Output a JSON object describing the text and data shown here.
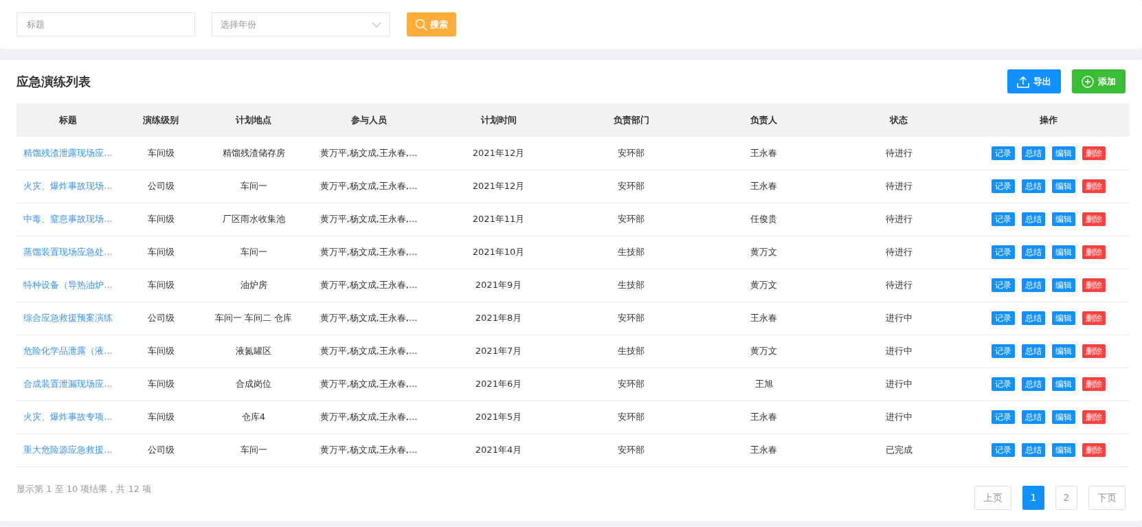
{
  "filters": {
    "title_placeholder": "标题",
    "year_placeholder": "选择年份",
    "search_button": "搜索"
  },
  "list": {
    "heading": "应急演练列表",
    "export_button": "导出",
    "add_button": "添加",
    "columns": [
      "标题",
      "演练级别",
      "计划地点",
      "参与人员",
      "计划时间",
      "负责部门",
      "负责人",
      "状态",
      "操作"
    ],
    "rows": [
      {
        "title": "精馏残渣泄露现场应...",
        "level": "车间级",
        "place": "精馏残渣储存房",
        "people": "黄万平,杨文成,王永春,...",
        "time": "2021年12月",
        "dept": "安环部",
        "owner": "王永春",
        "status": "待进行",
        "actions": [
          "记录",
          "总结",
          "编辑",
          "删除"
        ]
      },
      {
        "title": "火灾、爆炸事故现场...",
        "level": "公司级",
        "place": "车间一",
        "people": "黄万平,杨文成,王永春,...",
        "time": "2021年12月",
        "dept": "安环部",
        "owner": "王永春",
        "status": "待进行",
        "actions": [
          "记录",
          "总结",
          "编辑",
          "删除"
        ]
      },
      {
        "title": "中毒、窒息事故现场...",
        "level": "车间级",
        "place": "厂区雨水收集池",
        "people": "黄万平,杨文成,王永春,...",
        "time": "2021年11月",
        "dept": "安环部",
        "owner": "任俊贵",
        "status": "待进行",
        "actions": [
          "记录",
          "总结",
          "编辑",
          "删除"
        ]
      },
      {
        "title": "蒸馏装置现场应急处...",
        "level": "车间级",
        "place": "车间一",
        "people": "黄万平,杨文成,王永春,...",
        "time": "2021年10月",
        "dept": "生技部",
        "owner": "黄万文",
        "status": "待进行",
        "actions": [
          "记录",
          "总结",
          "编辑",
          "删除"
        ]
      },
      {
        "title": "特种设备（导热油炉...",
        "level": "车间级",
        "place": "油炉房",
        "people": "黄万平,杨文成,王永春,...",
        "time": "2021年9月",
        "dept": "生技部",
        "owner": "黄万文",
        "status": "待进行",
        "actions": [
          "记录",
          "总结",
          "编辑",
          "删除"
        ]
      },
      {
        "title": "综合应急救援预案演练",
        "level": "公司级",
        "place": "车间一 车间二 仓库",
        "people": "黄万平,杨文成,王永春,...",
        "time": "2021年8月",
        "dept": "安环部",
        "owner": "王永春",
        "status": "进行中",
        "actions": [
          "记录",
          "总结",
          "编辑",
          "删除"
        ]
      },
      {
        "title": "危险化学品泄露（液...",
        "level": "车间级",
        "place": "液氮罐区",
        "people": "黄万平,杨文成,王永春,...",
        "time": "2021年7月",
        "dept": "生技部",
        "owner": "黄万文",
        "status": "进行中",
        "actions": [
          "记录",
          "总结",
          "编辑",
          "删除"
        ]
      },
      {
        "title": "合成装置泄漏现场应...",
        "level": "车间级",
        "place": "合成岗位",
        "people": "黄万平,杨文成,王永春,...",
        "time": "2021年6月",
        "dept": "安环部",
        "owner": "王旭",
        "status": "进行中",
        "actions": [
          "记录",
          "总结",
          "编辑",
          "删除"
        ]
      },
      {
        "title": "火灾、爆炸事故专项...",
        "level": "车间级",
        "place": "仓库4",
        "people": "黄万平,杨文成,王永春,...",
        "time": "2021年5月",
        "dept": "安环部",
        "owner": "王永春",
        "status": "进行中",
        "actions": [
          "记录",
          "总结",
          "编辑",
          "删除"
        ]
      },
      {
        "title": "重大危险源应急救援...",
        "level": "公司级",
        "place": "车间一",
        "people": "黄万平,杨文成,王永春,...",
        "time": "2021年4月",
        "dept": "安环部",
        "owner": "王永春",
        "status": "已完成",
        "actions": [
          "记录",
          "总结",
          "编辑",
          "删除"
        ]
      }
    ],
    "summary": "显示第 1 至 10 项结果，共 12 项",
    "pagination": [
      {
        "label": "上页",
        "kind": "nav",
        "selected": false
      },
      {
        "label": "1",
        "kind": "page",
        "selected": true
      },
      {
        "label": "2",
        "kind": "page",
        "selected": false
      },
      {
        "label": "下页",
        "kind": "nav",
        "selected": false
      }
    ]
  }
}
